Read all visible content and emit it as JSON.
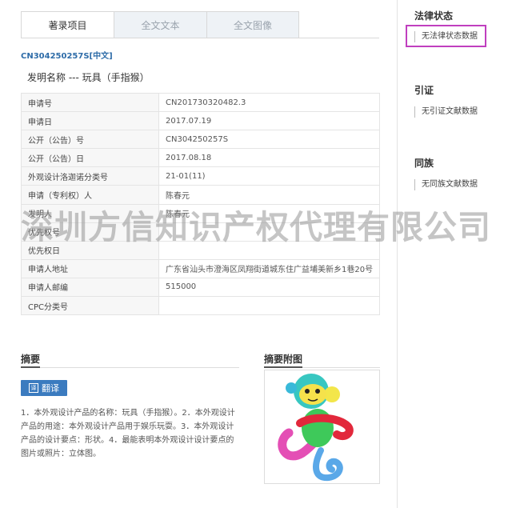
{
  "tabs": [
    "著录项目",
    "全文文本",
    "全文图像"
  ],
  "publication": {
    "number": "CN304250257S[中文]",
    "invention_name": "发明名称 ---  玩具（手指猴）"
  },
  "biblio": [
    {
      "key": "申请号",
      "value": "CN201730320482.3"
    },
    {
      "key": "申请日",
      "value": "2017.07.19"
    },
    {
      "key": "公开（公告）号",
      "value": "CN304250257S"
    },
    {
      "key": "公开（公告）日",
      "value": "2017.08.18"
    },
    {
      "key": "外观设计洛迦诺分类号",
      "value": "21-01(11)"
    },
    {
      "key": "申请（专利权）人",
      "value": "陈春元"
    },
    {
      "key": "发明人",
      "value": "陈春元"
    },
    {
      "key": "优先权号",
      "value": ""
    },
    {
      "key": "优先权日",
      "value": ""
    },
    {
      "key": "申请人地址",
      "value": "广东省汕头市澄海区凤翔街道城东住广益埔美新乡1巷20号"
    },
    {
      "key": "申请人邮编",
      "value": "515000"
    },
    {
      "key": "CPC分类号",
      "value": ""
    }
  ],
  "abstract": {
    "title": "摘要",
    "translate_label": "翻译",
    "translate_icon_text": "译",
    "text": "1．本外观设计产品的名称：玩具（手指猴）。2．本外观设计产品的用途：本外观设计产品用于娱乐玩耍。3．本外观设计产品的设计要点：形状。4．最能表明本外观设计设计要点的图片或照片：立体图。"
  },
  "figure": {
    "title": "摘要附图"
  },
  "sidebar": {
    "legal": {
      "title": "法律状态",
      "item": "无法律状态数据"
    },
    "citation": {
      "title": "引证",
      "item": "无引证文献数据"
    },
    "family": {
      "title": "同族",
      "item": "无同族文献数据"
    }
  },
  "watermark": "深圳方信知识产权代理有限公司",
  "colors": {
    "accent": "#3b7bbf",
    "highlight": "#c03fbf",
    "link": "#2e6ca8"
  }
}
